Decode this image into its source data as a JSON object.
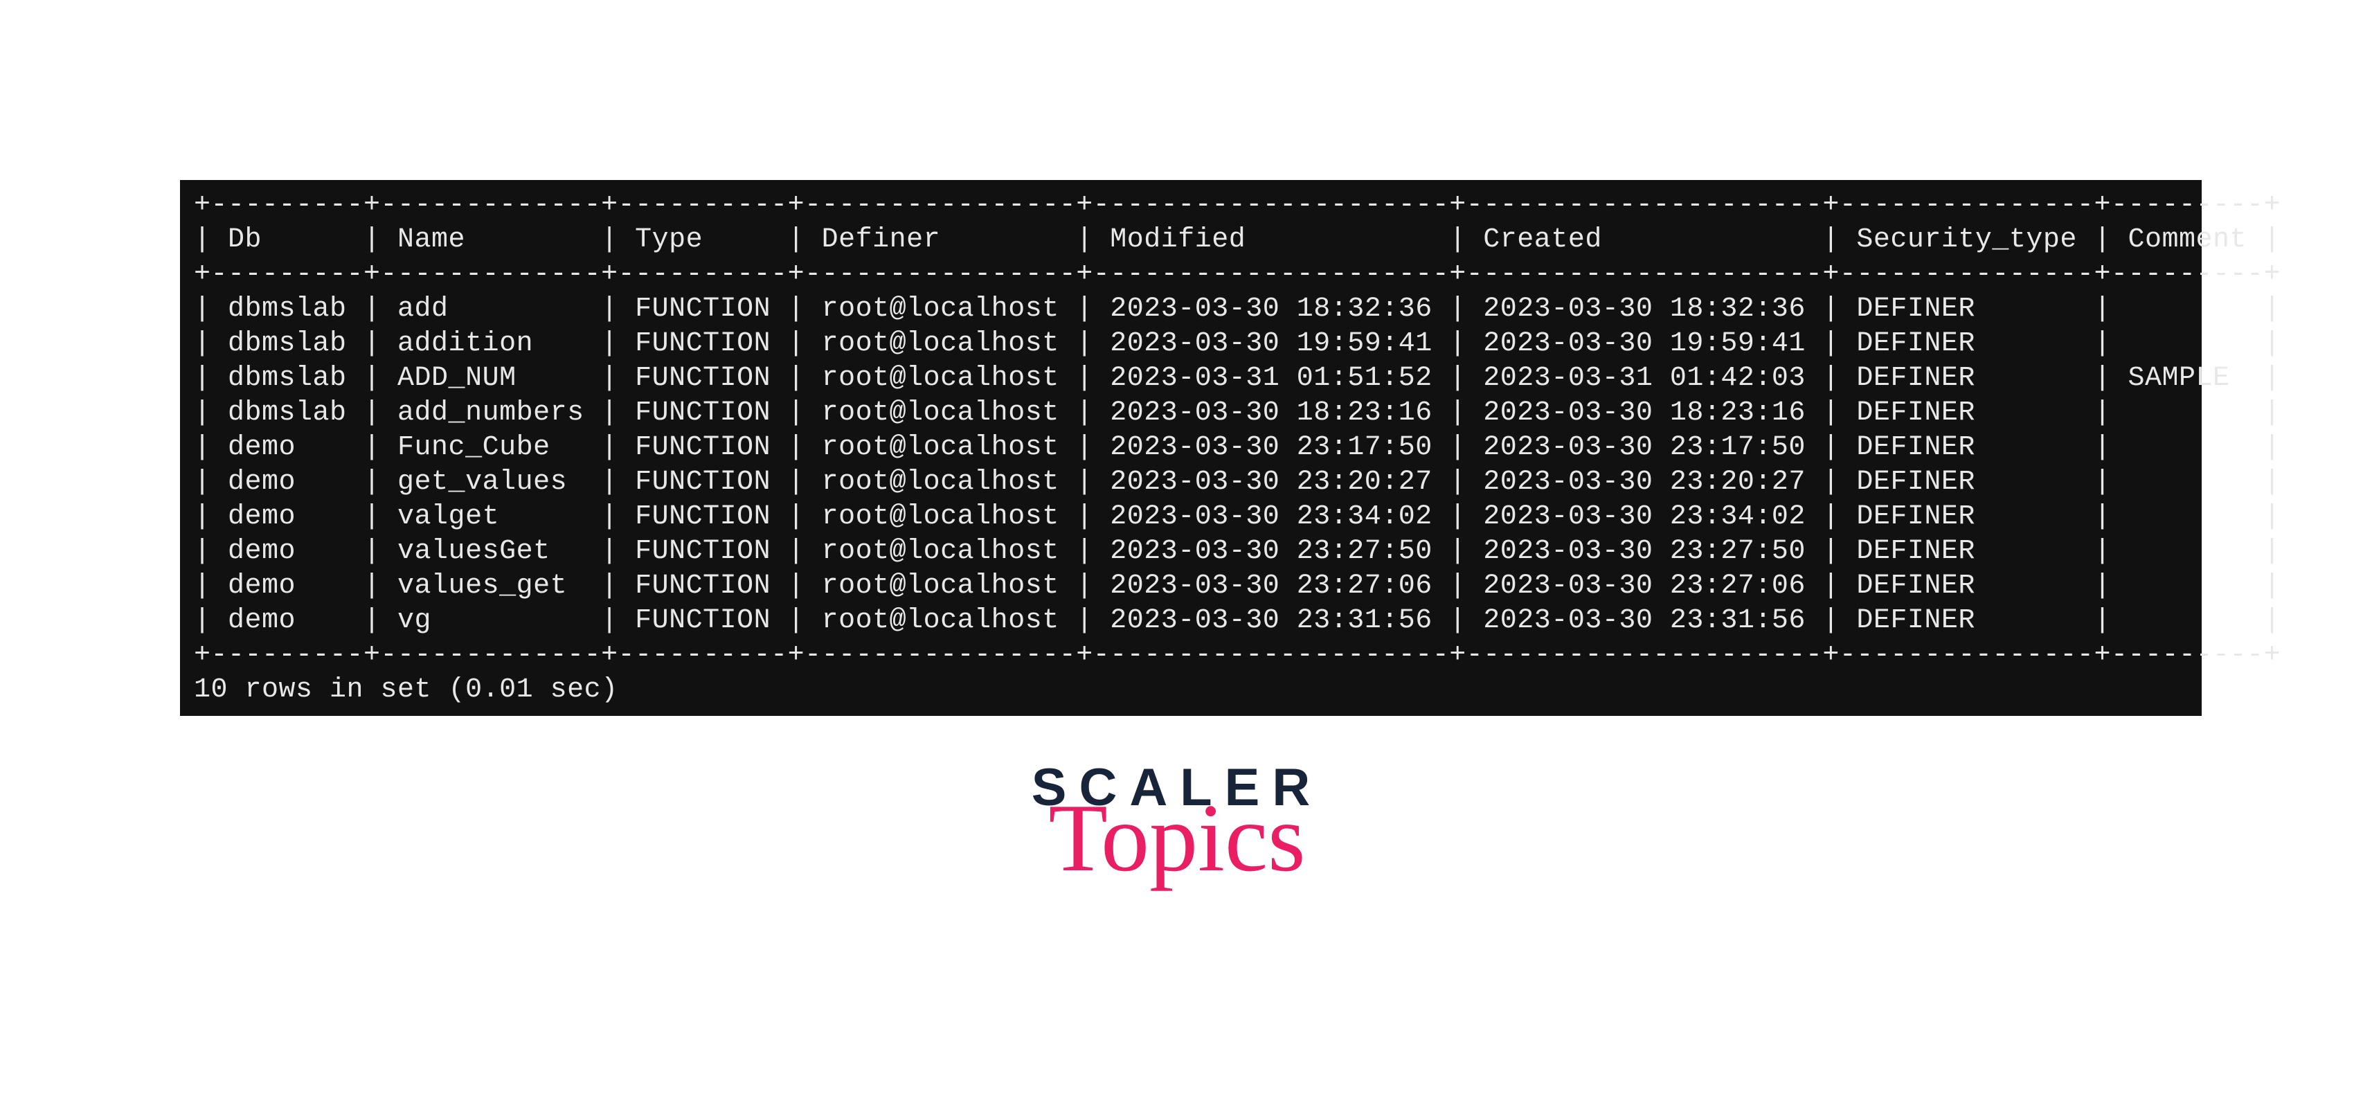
{
  "table": {
    "headers": [
      "Db",
      "Name",
      "Type",
      "Definer",
      "Modified",
      "Created",
      "Security_type",
      "Comment"
    ],
    "rows": [
      {
        "db": "dbmslab",
        "name": "add",
        "type": "FUNCTION",
        "definer": "root@localhost",
        "modified": "2023-03-30 18:32:36",
        "created": "2023-03-30 18:32:36",
        "security_type": "DEFINER",
        "comment": ""
      },
      {
        "db": "dbmslab",
        "name": "addition",
        "type": "FUNCTION",
        "definer": "root@localhost",
        "modified": "2023-03-30 19:59:41",
        "created": "2023-03-30 19:59:41",
        "security_type": "DEFINER",
        "comment": ""
      },
      {
        "db": "dbmslab",
        "name": "ADD_NUM",
        "type": "FUNCTION",
        "definer": "root@localhost",
        "modified": "2023-03-31 01:51:52",
        "created": "2023-03-31 01:42:03",
        "security_type": "DEFINER",
        "comment": "SAMPLE"
      },
      {
        "db": "dbmslab",
        "name": "add_numbers",
        "type": "FUNCTION",
        "definer": "root@localhost",
        "modified": "2023-03-30 18:23:16",
        "created": "2023-03-30 18:23:16",
        "security_type": "DEFINER",
        "comment": ""
      },
      {
        "db": "demo",
        "name": "Func_Cube",
        "type": "FUNCTION",
        "definer": "root@localhost",
        "modified": "2023-03-30 23:17:50",
        "created": "2023-03-30 23:17:50",
        "security_type": "DEFINER",
        "comment": ""
      },
      {
        "db": "demo",
        "name": "get_values",
        "type": "FUNCTION",
        "definer": "root@localhost",
        "modified": "2023-03-30 23:20:27",
        "created": "2023-03-30 23:20:27",
        "security_type": "DEFINER",
        "comment": ""
      },
      {
        "db": "demo",
        "name": "valget",
        "type": "FUNCTION",
        "definer": "root@localhost",
        "modified": "2023-03-30 23:34:02",
        "created": "2023-03-30 23:34:02",
        "security_type": "DEFINER",
        "comment": ""
      },
      {
        "db": "demo",
        "name": "valuesGet",
        "type": "FUNCTION",
        "definer": "root@localhost",
        "modified": "2023-03-30 23:27:50",
        "created": "2023-03-30 23:27:50",
        "security_type": "DEFINER",
        "comment": ""
      },
      {
        "db": "demo",
        "name": "values_get",
        "type": "FUNCTION",
        "definer": "root@localhost",
        "modified": "2023-03-30 23:27:06",
        "created": "2023-03-30 23:27:06",
        "security_type": "DEFINER",
        "comment": ""
      },
      {
        "db": "demo",
        "name": "vg",
        "type": "FUNCTION",
        "definer": "root@localhost",
        "modified": "2023-03-30 23:31:56",
        "created": "2023-03-30 23:31:56",
        "security_type": "DEFINER",
        "comment": ""
      }
    ],
    "footer": "10 rows in set (0.01 sec)"
  },
  "logo": {
    "line1": "SCALER",
    "line2": "Topics"
  }
}
